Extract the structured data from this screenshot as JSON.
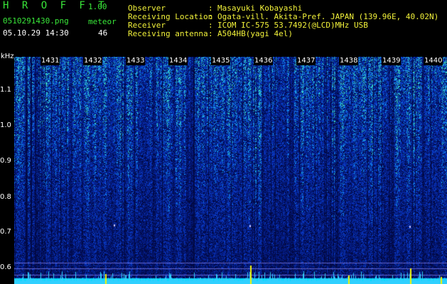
{
  "header": {
    "app_title": "HROFFT",
    "version": "1.00",
    "file_name": "0510291430.png",
    "meteor_label": "meteor",
    "timestamp": "05.10.29 14:30",
    "meteor_count": "46"
  },
  "station_info": [
    {
      "label": "Observer",
      "value": "Masayuki Kobayashi"
    },
    {
      "label": "Receiving Location",
      "value": "Ogata-vill. Akita-Pref. JAPAN (139.96E, 40.02N)"
    },
    {
      "label": "Receiver",
      "value": "ICOM IC-575 53.7492(@LCD)MHz USB"
    },
    {
      "label": "Receiving antenna",
      "value": "A504HB(yagi 4el)"
    }
  ],
  "spectrogram": {
    "y_unit": "kHz",
    "y_ticks": [
      "1.1",
      "1.0",
      "0.9",
      "0.8",
      "0.7",
      "0.6"
    ],
    "x_ticks": [
      "1431",
      "1432",
      "1433",
      "1434",
      "1435",
      "1436",
      "1437",
      "1438",
      "1439",
      "1440"
    ],
    "y_range_khz": [
      0.585,
      1.195
    ],
    "colors": {
      "background": "#0a1a7a",
      "dark": "#020840",
      "cyan": "#00e0ff",
      "green": "#34c878",
      "yellow": "#f5f500",
      "accent_green": "#39e639",
      "accent_yellow": "#f2f23a"
    }
  }
}
